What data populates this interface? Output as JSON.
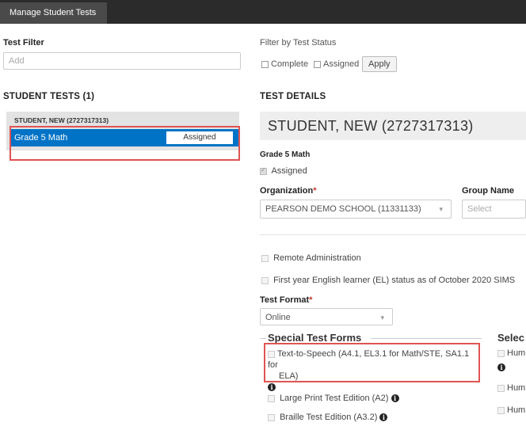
{
  "window": {
    "tab_title": "Manage Student Tests"
  },
  "left": {
    "test_filter_label": "Test Filter",
    "test_filter_placeholder": "Add",
    "student_tests_title": "STUDENT TESTS (1)",
    "group_label": "STUDENT, NEW (2727317313)",
    "test_name": "Grade 5 Math",
    "test_status": "Assigned"
  },
  "filter": {
    "label": "Filter by Test Status",
    "complete": "Complete",
    "assigned": "Assigned",
    "apply": "Apply"
  },
  "details": {
    "title": "TEST DETAILS",
    "student_name": "STUDENT, NEW (2727317313)",
    "test_name": "Grade 5 Math",
    "assigned_label": "Assigned",
    "organization_label": "Organization",
    "required_mark": "*",
    "organization_value": "PEARSON DEMO SCHOOL (11331133)",
    "group_label": "Group Name",
    "group_placeholder": "Select",
    "remote_admin": "Remote Administration",
    "el_status": "First year English learner (EL) status as of October 2020 SIMS",
    "test_format_label": "Test Format",
    "test_format_value": "Online"
  },
  "special_forms": {
    "title": "Special Test Forms",
    "tts_line1": "Text-to-Speech (A4.1, EL3.1 for Math/STE, SA1.1 for",
    "tts_line2": "ELA)",
    "large_print": "Large Print Test Edition (A2)",
    "braille": "Braille Test Edition (A3.2)"
  },
  "select_col": {
    "title": "Selec",
    "item1": "Hum",
    "item2": "Hum",
    "item3": "Hum"
  },
  "icons": {
    "info": "i"
  }
}
